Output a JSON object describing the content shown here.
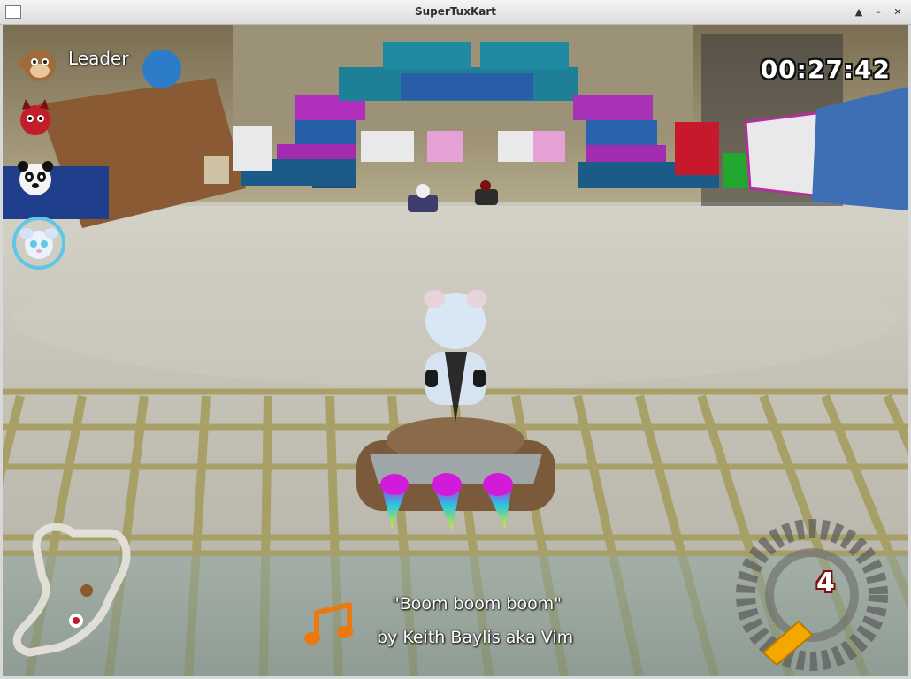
{
  "window": {
    "title": "SuperTuxKart",
    "controls": [
      "up-arrow-icon",
      "minimize-icon",
      "close-icon"
    ]
  },
  "hud": {
    "ranking": {
      "leader_label": "Leader",
      "racers": [
        {
          "name": "monkey",
          "icon": "monkey-icon"
        },
        {
          "name": "devil",
          "icon": "devil-icon"
        },
        {
          "name": "panda",
          "icon": "panda-icon"
        },
        {
          "name": "player",
          "icon": "player-avatar-icon",
          "highlighted": true
        }
      ]
    },
    "timer": "00:27:42",
    "music": {
      "title": "\"Boom boom boom\"",
      "artist": "by Keith Baylis aka Vim",
      "icon": "music-note-icon"
    },
    "speedometer": {
      "value": "4",
      "icon": "speedometer-icon"
    },
    "minimap": {
      "icon": "track-minimap"
    },
    "colors": {
      "timer_text": "#ffffff",
      "speed_number": "#ffffff",
      "nitro_gauge": "#f5a700",
      "music_note": "#e87a10",
      "player_ring": "#5fc6e8"
    }
  }
}
